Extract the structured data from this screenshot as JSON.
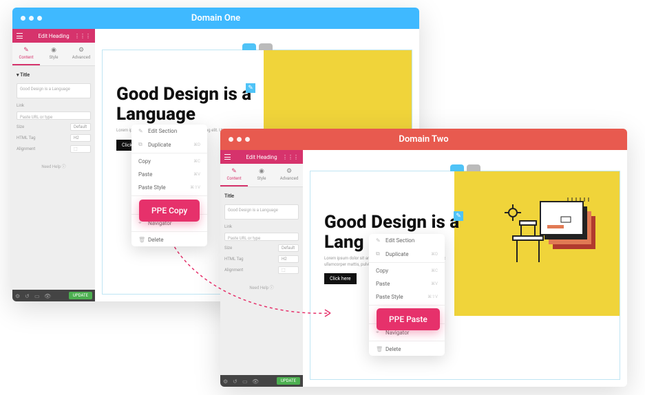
{
  "windows": {
    "one": {
      "title": "Domain One"
    },
    "two": {
      "title": "Domain Two"
    }
  },
  "sidebar": {
    "header": "Edit Heading",
    "tabs": {
      "content": "Content",
      "style": "Style",
      "advanced": "Advanced"
    },
    "section_title": "▾ Title",
    "title_label": "Title",
    "textarea_value": "Good Design is a Language",
    "link_label": "Link",
    "link_placeholder": "Paste URL or type",
    "size_label": "Size",
    "size_value": "Default",
    "htmltag_label": "HTML Tag",
    "htmltag_value": "H2",
    "alignment_label": "Alignment",
    "need_help": "Need Help ⓘ",
    "update": "UPDATE"
  },
  "canvas": {
    "heading_partial_one": "Good Design is a Language",
    "heading_partial_two": "Good Design is a Lang",
    "lorem_one": "Lorem ipsum dolor sit amet, consectetur adipiscing elit. Ut ...",
    "lorem_two": "Lorem ipsum dolor sit amet, consectetur adipiscing elit, luctus nec ullamcorper mattis, pulvi",
    "click_here": "Click here"
  },
  "context_menu": {
    "edit_section": "Edit Section",
    "duplicate": "Duplicate",
    "dup_kbd": "⌘D",
    "copy": "Copy",
    "copy_kbd": "⌘C",
    "paste": "Paste",
    "paste_kbd": "⌘V",
    "paste_style": "Paste Style",
    "paste_style_kbd": "⌘⇧V",
    "navigator": "Navigator",
    "delete": "Delete"
  },
  "ppe": {
    "copy": "PPE Copy",
    "paste": "PPE Paste"
  }
}
